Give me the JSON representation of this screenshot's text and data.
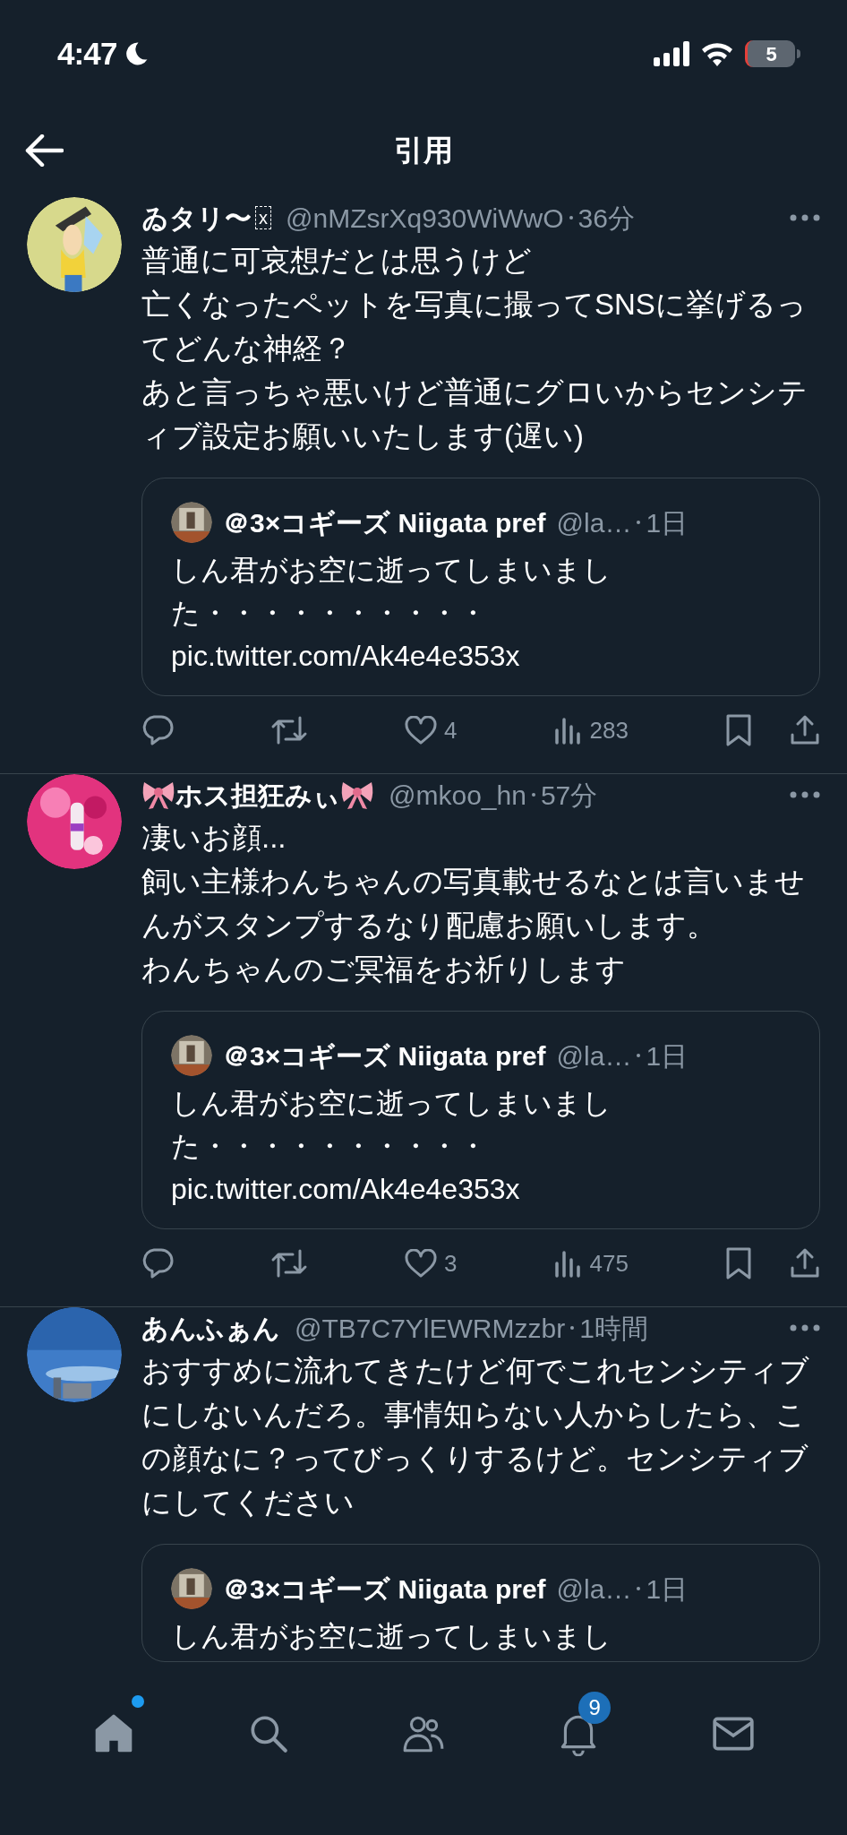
{
  "status_bar": {
    "time": "4:47",
    "battery": "5"
  },
  "header": {
    "title": "引用"
  },
  "tweets": [
    {
      "name": "ゐタリ〜",
      "name_badge": "x",
      "ribbons": false,
      "handle": "@nMZsrXq930WiWwO",
      "time": "36分",
      "paragraphs": [
        "普通に可哀想だとは思うけど",
        "亡くなったペットを写真に撮ってSNSに挙げるってどんな神経？",
        "あと言っちゃ悪いけど普通にグロいからセンシティブ設定お願いいたします(遅い)"
      ],
      "quote": {
        "name": "＠3×コギーズ Niigata pref",
        "handle": "@la…",
        "time": "1日",
        "text": "しん君がお空に逝ってしまいました・・・・・・・・・・ pic.twitter.com/Ak4e4e353x"
      },
      "likes": "4",
      "views": "283"
    },
    {
      "name": "ホス担狂みぃ",
      "ribbons": true,
      "handle": "@mkoo_hn",
      "time": "57分",
      "paragraphs": [
        "凄いお顔...",
        "飼い主様わんちゃんの写真載せるなとは言いませんがスタンプするなり配慮お願いします。",
        "わんちゃんのご冥福をお祈りします"
      ],
      "quote": {
        "name": "＠3×コギーズ Niigata pref",
        "handle": "@la…",
        "time": "1日",
        "text": "しん君がお空に逝ってしまいました・・・・・・・・・・ pic.twitter.com/Ak4e4e353x"
      },
      "likes": "3",
      "views": "475"
    },
    {
      "name": "あんふぁん",
      "ribbons": false,
      "handle": "@TB7C7YlEWRMzzbr",
      "time": "1時間",
      "paragraphs": [
        "おすすめに流れてきたけど何でこれセンシティブにしないんだろ。事情知らない人からしたら、この顔なに？ってびっくりするけど。センシティブにしてください"
      ],
      "quote": {
        "name": "＠3×コギーズ Niigata pref",
        "handle": "@la…",
        "time": "1日",
        "text": "しん君がお空に逝ってしまいまし"
      }
    }
  ],
  "bottom_nav": {
    "items": [
      {
        "kind": "home",
        "selected": true,
        "dot": true
      },
      {
        "kind": "search",
        "selected": false
      },
      {
        "kind": "communities",
        "selected": false
      },
      {
        "kind": "notifications",
        "selected": false,
        "badge": "9"
      },
      {
        "kind": "messages",
        "selected": false
      }
    ]
  }
}
